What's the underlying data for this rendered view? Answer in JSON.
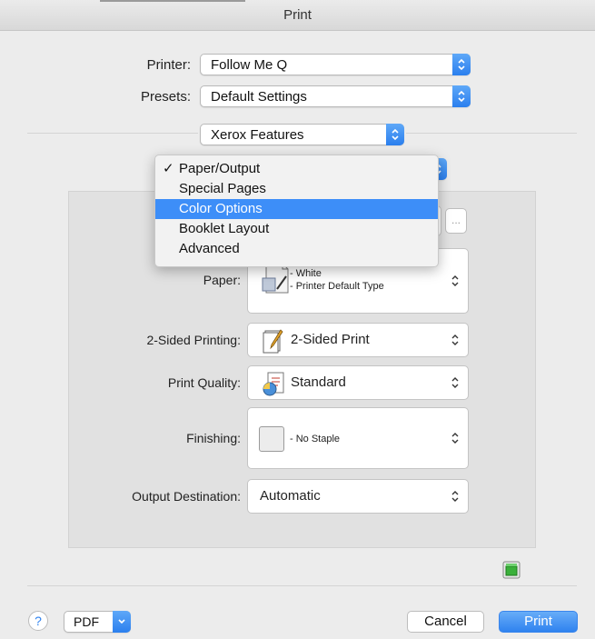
{
  "window": {
    "title": "Print"
  },
  "printer": {
    "label": "Printer:",
    "value": "Follow Me Q"
  },
  "presets": {
    "label": "Presets:",
    "value": "Default Settings"
  },
  "section_popup": {
    "value": "Xerox Features"
  },
  "menu": {
    "checkmark": "✓",
    "items": [
      {
        "label": "Paper/Output",
        "checked": true,
        "highlighted": false
      },
      {
        "label": "Special Pages",
        "checked": false,
        "highlighted": false
      },
      {
        "label": "Color Options",
        "checked": false,
        "highlighted": true
      },
      {
        "label": "Booklet Layout",
        "checked": false,
        "highlighted": false
      },
      {
        "label": "Advanced",
        "checked": false,
        "highlighted": false
      }
    ]
  },
  "settings": {
    "ellipsis": "...",
    "paper": {
      "label": "Paper:",
      "line1": "- White",
      "line2": "- Printer Default Type"
    },
    "sided": {
      "label": "2-Sided Printing:",
      "value": "2-Sided Print"
    },
    "quality": {
      "label": "Print Quality:",
      "value": "Standard"
    },
    "finishing": {
      "label": "Finishing:",
      "value": "- No Staple"
    },
    "output": {
      "label": "Output Destination:",
      "value": "Automatic"
    }
  },
  "footer": {
    "help": "?",
    "pdf": "PDF",
    "cancel": "Cancel",
    "print": "Print"
  },
  "colors": {
    "accent": "#3d8ef8",
    "panel": "#e1e1e1",
    "background": "#ececec"
  }
}
